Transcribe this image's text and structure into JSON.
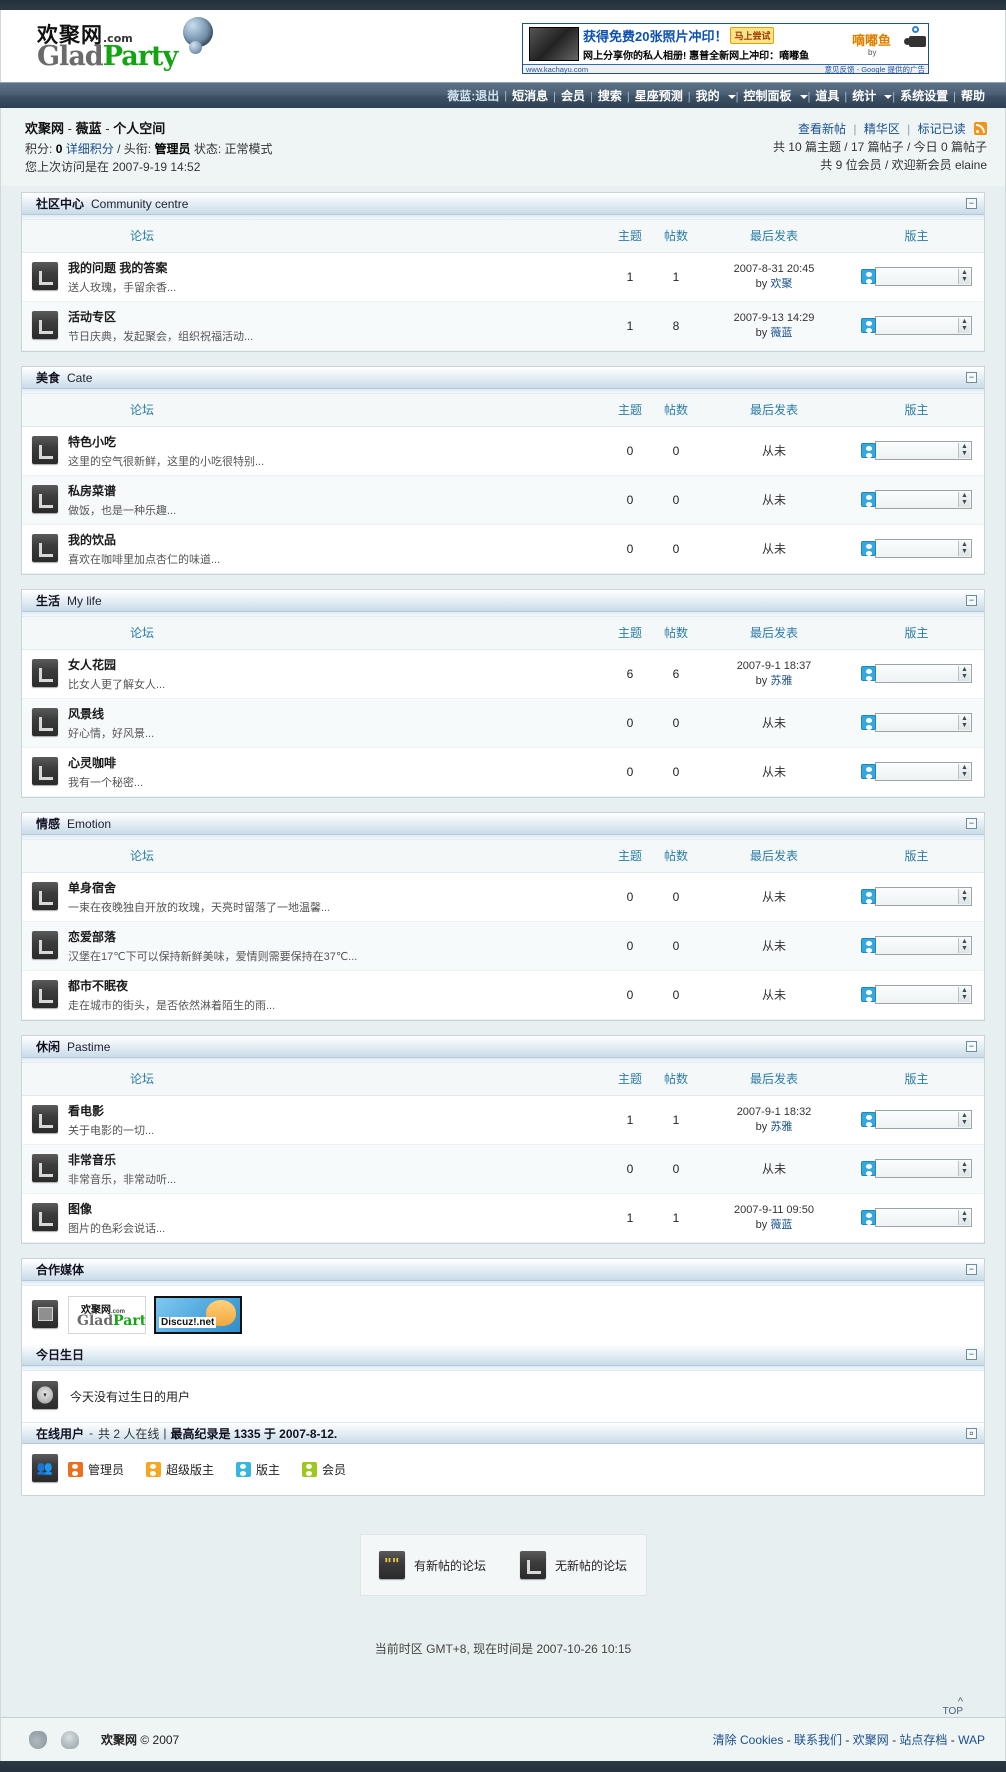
{
  "site": {
    "logo_cn": "欢聚网",
    "logo_dotcom": ".com",
    "logo_en_glad": "Glad",
    "logo_en_party": "Party"
  },
  "ad": {
    "headline": "获得免费20张照片冲印！",
    "try_label": "马上尝试",
    "subline": "网上分享你的私人相册! 惠普全新网上冲印：嘀嘟鱼",
    "url": "www.kachayu.com",
    "feedback": "意见反馈 - Google 提供的广告",
    "brand": "嘀嘟鱼",
    "brand_by": "by"
  },
  "nav": {
    "user_logout": "薇蓝:退出",
    "items": [
      {
        "label": "短消息",
        "caret": false
      },
      {
        "label": "会员",
        "caret": false
      },
      {
        "label": "搜索",
        "caret": false
      },
      {
        "label": "星座预测",
        "caret": false
      },
      {
        "label": "我的",
        "caret": true
      },
      {
        "label": "控制面板",
        "caret": true
      },
      {
        "label": "道具",
        "caret": false
      },
      {
        "label": "统计",
        "caret": true
      },
      {
        "label": "系统设置",
        "caret": false
      },
      {
        "label": "帮助",
        "caret": false
      }
    ]
  },
  "userinfo": {
    "title_site": "欢聚网",
    "title_sep1": "-",
    "title_user": "薇蓝",
    "title_sep2": "-",
    "title_space": "个人空间",
    "credits_label": "积分:",
    "credits_value": "0",
    "credits_link": "详细积分",
    "slash": "/",
    "rank_label": "头衔:",
    "rank_value": "管理员",
    "status_label": "状态:",
    "status_value": "正常模式",
    "lastvisit": "您上次访问是在  2007-9-19 14:52",
    "newposts_link": "查看新帖",
    "digest_link": "精华区",
    "markread_link": "标记已读",
    "stats_line1": "共  10 篇主题 / 17 篇帖子 / 今日  0 篇帖子",
    "stats_line2": "共  9 位会员 / 欢迎新会员  elaine"
  },
  "table_headers": {
    "forum": "论坛",
    "threads": "主题",
    "posts": "帖数",
    "lastpost": "最后发表",
    "moderator": "版主"
  },
  "categories": [
    {
      "cn": "社区中心",
      "en": "Community centre",
      "forums": [
        {
          "name": "我的问题  我的答案",
          "desc": "送人玫瑰，手留余香...",
          "threads": "1",
          "posts": "1",
          "last_time": "2007-8-31 20:45",
          "last_by_prefix": "by",
          "last_by": "欢聚"
        },
        {
          "name": "活动专区",
          "desc": "节日庆典，发起聚会，组织祝福活动...",
          "threads": "1",
          "posts": "8",
          "last_time": "2007-9-13 14:29",
          "last_by_prefix": "by",
          "last_by": "薇蓝"
        }
      ]
    },
    {
      "cn": "美食",
      "en": "Cate",
      "forums": [
        {
          "name": "特色小吃",
          "desc": "这里的空气很新鲜，这里的小吃很特别...",
          "threads": "0",
          "posts": "0",
          "last_time": "从未",
          "last_by_prefix": "",
          "last_by": ""
        },
        {
          "name": "私房菜谱",
          "desc": "做饭，也是一种乐趣...",
          "threads": "0",
          "posts": "0",
          "last_time": "从未",
          "last_by_prefix": "",
          "last_by": ""
        },
        {
          "name": "我的饮品",
          "desc": "喜欢在咖啡里加点杏仁的味道...",
          "threads": "0",
          "posts": "0",
          "last_time": "从未",
          "last_by_prefix": "",
          "last_by": ""
        }
      ]
    },
    {
      "cn": "生活",
      "en": "My life",
      "forums": [
        {
          "name": "女人花园",
          "desc": "比女人更了解女人...",
          "threads": "6",
          "posts": "6",
          "last_time": "2007-9-1 18:37",
          "last_by_prefix": "by",
          "last_by": "苏雅"
        },
        {
          "name": "风景线",
          "desc": "好心情，好风景...",
          "threads": "0",
          "posts": "0",
          "last_time": "从未",
          "last_by_prefix": "",
          "last_by": ""
        },
        {
          "name": "心灵咖啡",
          "desc": "我有一个秘密...",
          "threads": "0",
          "posts": "0",
          "last_time": "从未",
          "last_by_prefix": "",
          "last_by": ""
        }
      ]
    },
    {
      "cn": "情感",
      "en": "Emotion",
      "forums": [
        {
          "name": "单身宿舍",
          "desc": "一束在夜晚独自开放的玫瑰，天亮时留落了一地温馨...",
          "threads": "0",
          "posts": "0",
          "last_time": "从未",
          "last_by_prefix": "",
          "last_by": ""
        },
        {
          "name": "恋爱部落",
          "desc": "汉堡在17℃下可以保持新鲜美味，爱情则需要保持在37℃...",
          "threads": "0",
          "posts": "0",
          "last_time": "从未",
          "last_by_prefix": "",
          "last_by": ""
        },
        {
          "name": "都市不眠夜",
          "desc": "走在城市的街头，是否依然淋着陌生的雨...",
          "threads": "0",
          "posts": "0",
          "last_time": "从未",
          "last_by_prefix": "",
          "last_by": ""
        }
      ]
    },
    {
      "cn": "休闲",
      "en": "Pastime",
      "forums": [
        {
          "name": "看电影",
          "desc": "关于电影的一切...",
          "threads": "1",
          "posts": "1",
          "last_time": "2007-9-1 18:32",
          "last_by_prefix": "by",
          "last_by": "苏雅"
        },
        {
          "name": "非常音乐",
          "desc": "非常音乐，非常动听...",
          "threads": "0",
          "posts": "0",
          "last_time": "从未",
          "last_by_prefix": "",
          "last_by": ""
        },
        {
          "name": "图像",
          "desc": "图片的色彩会说话...",
          "threads": "1",
          "posts": "1",
          "last_time": "2007-9-11 09:50",
          "last_by_prefix": "by",
          "last_by": "薇蓝"
        }
      ]
    }
  ],
  "media": {
    "title": "合作媒体",
    "logo1_cn": "欢聚网",
    "logo1_dotcom": ".com",
    "logo1_glad": "Glad",
    "logo1_party": "Party",
    "logo2_text": "Discuz!.net"
  },
  "birthday": {
    "title": "今日生日",
    "text": "今天没有过生日的用户"
  },
  "online": {
    "title": "在线用户",
    "dash": "-",
    "summary": "共  2 人在线",
    "pipe": "|",
    "record": "最高纪录是  1335 于  2007-8-12.",
    "roles": [
      {
        "label": "管理员",
        "color": "#ef6d1e"
      },
      {
        "label": "超级版主",
        "color": "#f5a623"
      },
      {
        "label": "版主",
        "color": "#36b6e0"
      },
      {
        "label": "会员",
        "color": "#9dc81f"
      }
    ]
  },
  "legend": {
    "new": "有新帖的论坛",
    "old": "无新帖的论坛"
  },
  "footer": {
    "timezone": "当前时区  GMT+8, 现在时间是  2007-10-26 10:15",
    "top": "TOP",
    "copyright_site": "欢聚网",
    "copyright_mark": "© 2007",
    "links": [
      {
        "label": "清除 Cookies"
      },
      {
        "label": "联系我们"
      },
      {
        "label": "欢聚网"
      },
      {
        "label": "站点存档"
      },
      {
        "label": "WAP"
      }
    ]
  }
}
